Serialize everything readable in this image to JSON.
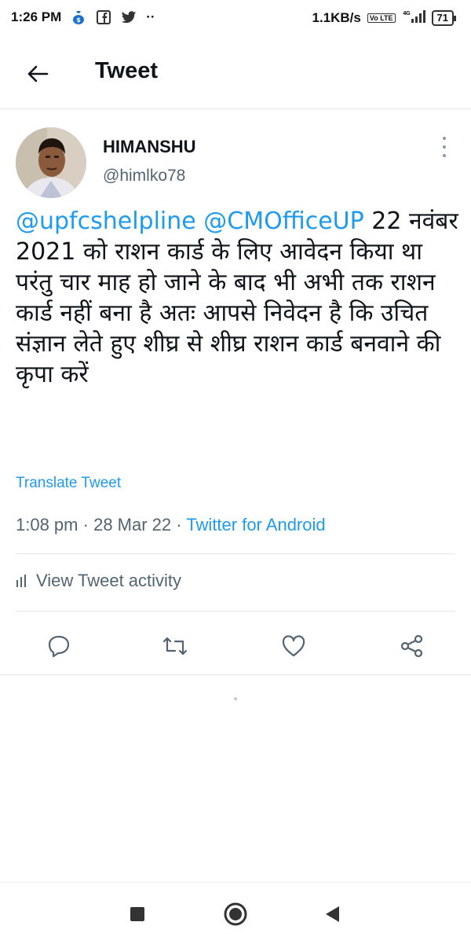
{
  "status_bar": {
    "time": "1:26 PM",
    "left_icons": [
      "money-bag-icon",
      "facebook-icon",
      "twitter-icon",
      "more-dots-icon"
    ],
    "dots": "··",
    "speed": "1.1KB/s",
    "network": "4G",
    "volte": "Vo LTE",
    "battery": "71"
  },
  "header": {
    "title": "Tweet"
  },
  "tweet": {
    "author_name": "HIMANSHU",
    "author_handle": "@himlko78",
    "mention_1": "@upfcshelpline",
    "mention_2": "@CMOfficeUP",
    "body": " 22 नवंबर 2021 को राशन कार्ड के लिए आवेदन किया था परंतु चार माह हो जाने के बाद भी अभी तक राशन कार्ड नहीं बना है अतः आपसे निवेदन है कि उचित संज्ञान लेते हुए शीघ्र से शीघ्र राशन कार्ड बनवाने की कृपा करें",
    "translate_label": "Translate Tweet",
    "time": "1:08 pm",
    "separator": "·",
    "date": "28 Mar 22",
    "source": "Twitter for Android"
  },
  "activity": {
    "label": "View Tweet activity"
  },
  "colors": {
    "accent": "#1d9bf0",
    "muted": "#536471",
    "divider": "#e6e6e6"
  }
}
